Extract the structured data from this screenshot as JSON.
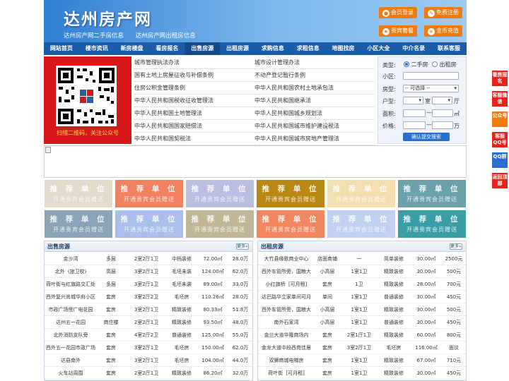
{
  "site": {
    "title": "达州房产网",
    "subtitle_links": [
      "达州房产网二手房信息",
      "达州房产网出租房信息"
    ]
  },
  "header_buttons": [
    "会员登录",
    "免费注册",
    "贵宾套餐",
    "金币充值"
  ],
  "nav": [
    "网站首页",
    "楼市资讯",
    "新房楼盘",
    "看房报名",
    "出售房源",
    "出租房源",
    "求购信息",
    "求租信息",
    "地图找房",
    "小区大全",
    "中介名录",
    "联系客服"
  ],
  "nav_active": 4,
  "qr_caption": "扫描二维码，关注公众号",
  "links_left": [
    "城市管理执法办法",
    "国有土地上房屋征收与补偿条例",
    "住房公积金管理条例",
    "中华人民共和国税收征收管理法",
    "中华人民共和国土地管理法",
    "中华人民共和国国家赔偿法",
    "中华人民共和国契税法"
  ],
  "links_right": [
    "城市设计管理办法",
    "不动产登记暂行条例",
    "中华人民共和国农村土地承包法",
    "中华人民共和国继承法",
    "中华人民共和国城乡规划法",
    "中华人民共和国城市维护建设税法",
    "中华人民共和国城市房地产管理法"
  ],
  "search": {
    "type_label": "类型:",
    "type_options": [
      "二手房",
      "出租房"
    ],
    "type_selected": 0,
    "community_label": "小区:",
    "house_type_label": "房型:",
    "house_type_value": "-- 可选择 --",
    "layout_label": "户型:",
    "room_unit": "室",
    "hall_unit": "厅",
    "area_label": "面积:",
    "area_unit": "㎡",
    "price_label": "价格:",
    "price_unit": "万",
    "submit_label": "确认提交搜索"
  },
  "ads": {
    "line1": "推 荐 单 位",
    "line2": "开通贵宾会员赠送",
    "colors": [
      "#e3dccd",
      "#f08060",
      "#b9bee0",
      "#b88714",
      "#f3dfb0",
      "#6aa1aa",
      "#8aa3b5",
      "#abbdea",
      "#c2b699",
      "#f2875f",
      "#c1cff0",
      "#3a9ea7"
    ]
  },
  "sale": {
    "title": "出售房源",
    "more": "更多»",
    "rows": [
      [
        "金沙湾",
        "多层",
        "2室2厅1卫",
        "中档装修",
        "72.00㎡",
        "28.0万"
      ],
      [
        "北外（旅卫校)",
        "高层",
        "3室2厅1卫",
        "毛坯未装",
        "124.00㎡",
        "62.0万"
      ],
      [
        "荷叶街与红旗路交汇处",
        "多层",
        "3室2厅1卫",
        "毛坯未装",
        "89.00㎡",
        "33.0万"
      ],
      [
        "西外复兴尚城华府小区",
        "套房",
        "3室2厅2卫",
        "毛坯房",
        "110.26㎡",
        "28.0万"
      ],
      [
        "市政广场傍广电花园",
        "套房",
        "3室2厅1卫",
        "精致装修",
        "80.33㎡",
        "51.8万"
      ],
      [
        "达州五一花园",
        "商住楼",
        "2室2厅1卫",
        "精致装修",
        "93.50㎡",
        "48.0万"
      ],
      [
        "北外消防支队旁",
        "套房",
        "4室2厅2卫",
        "普通装修",
        "125.00㎡",
        "55.0万"
      ],
      [
        "西外五一花园市政广场",
        "套房",
        "3室2厅1卫",
        "毛坯房",
        "150.00㎡",
        "62.0万"
      ],
      [
        "达县南外",
        "套房",
        "3室2厅1卫",
        "毛坯房",
        "104.00㎡",
        "44.0万"
      ],
      [
        "火车站周围",
        "套房",
        "2室2厅1卫",
        "精致装修",
        "86.20㎡",
        "32.0万"
      ]
    ]
  },
  "rent": {
    "title": "出租房源",
    "more": "更多»",
    "rows": [
      [
        "大竹县缘歌商业中心",
        "店面商铺",
        "一",
        "简单装修",
        "30.00㎡",
        "2500元"
      ],
      [
        "西外车管所旁，国粮大",
        "小高层",
        "1室1卫",
        "精致装修",
        "30.00㎡",
        "500元"
      ],
      [
        "小红旗桥［可月租]",
        "套房",
        "1卫",
        "精致装修",
        "28.00㎡",
        "700元"
      ],
      [
        "达巴路华立家单间可月",
        "单间",
        "1室1卫",
        "普通装修",
        "30.00㎡",
        "450元"
      ],
      [
        "西外车管所旁，国粮大",
        "小高层",
        "1室1卫",
        "精致装修",
        "30.00㎡",
        "500元"
      ],
      [
        "南外石家湾",
        "小高层",
        "1室1卫",
        "普通装修",
        "30.00㎡",
        "450元"
      ],
      [
        "金兰大道华隆商场内",
        "套房",
        "2室1厅1卫",
        "精致装修",
        "60.00㎡",
        "800元"
      ],
      [
        "金龙大道中段西苑佳居",
        "套房",
        "3室2厅1卫",
        "毛坯房",
        "116.00㎡",
        "面议"
      ],
      [
        "双狮商城电梯房",
        "套房",
        "1室1卫",
        "精致装修",
        "67.00㎡",
        "710元"
      ],
      [
        "荷叶街［可月租]",
        "套房",
        "1室1卫",
        "精致装修",
        "30.00㎡",
        "450元"
      ]
    ]
  },
  "right_buttons": [
    "看房报名",
    "客服微信",
    "公众号",
    "客服QQ号",
    "QQ群",
    "返回顶部"
  ]
}
